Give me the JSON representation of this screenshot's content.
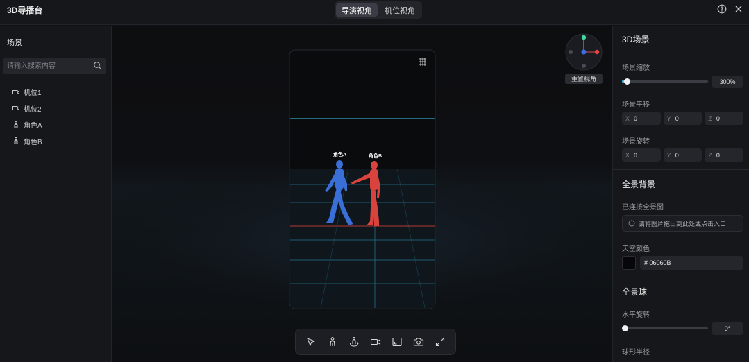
{
  "header": {
    "title": "3D导播台",
    "tabs": [
      {
        "label": "导演视角",
        "active": true
      },
      {
        "label": "机位视角",
        "active": false
      }
    ],
    "help_icon": "help-circle-icon",
    "close_icon": "close-icon"
  },
  "left": {
    "heading": "场景",
    "search_placeholder": "请输入搜索内容",
    "items": [
      {
        "label": "机位1",
        "icon": "camera-icon"
      },
      {
        "label": "机位2",
        "icon": "camera-icon"
      },
      {
        "label": "角色A",
        "icon": "person-icon"
      },
      {
        "label": "角色B",
        "icon": "person-icon"
      }
    ]
  },
  "viewport": {
    "gizmo_label": "重置视角",
    "figure_a_label": "角色A",
    "figure_b_label": "角色B",
    "colors": {
      "figure_a": "#3a6fd8",
      "figure_b": "#d9433d",
      "grid": "#3ec0e6"
    },
    "toolbar": [
      "select-arrow-icon",
      "person-add-icon",
      "rotate-figure-icon",
      "camera-icon",
      "frame-icon",
      "snapshot-icon",
      "fullscreen-icon"
    ]
  },
  "right": {
    "scene3d": {
      "title": "3D场景",
      "zoom_label": "场景缩放",
      "zoom_value": "300%",
      "zoom_fraction": 0.06,
      "translate_label": "场景平移",
      "translate": [
        {
          "axis": "X",
          "value": "0"
        },
        {
          "axis": "Y",
          "value": "0"
        },
        {
          "axis": "Z",
          "value": "0"
        }
      ],
      "rotate_label": "场景旋转",
      "rotate": [
        {
          "axis": "X",
          "value": "0"
        },
        {
          "axis": "Y",
          "value": "0"
        },
        {
          "axis": "Z",
          "value": "0"
        }
      ]
    },
    "panorama": {
      "title": "全景背景",
      "linked_label": "已连接全景图",
      "upload_text": "请将图片拖出到此处或点击入口",
      "sky_label": "天空颜色",
      "sky_color": "#06060B",
      "sky_text": "# 06060B"
    },
    "sphere": {
      "title": "全景球",
      "h_rotate_label": "水平旋转",
      "h_rotate_value": "0°",
      "h_rotate_fraction": 0.0,
      "radius_label": "球形半径"
    },
    "accent": "#3ec0e6"
  }
}
